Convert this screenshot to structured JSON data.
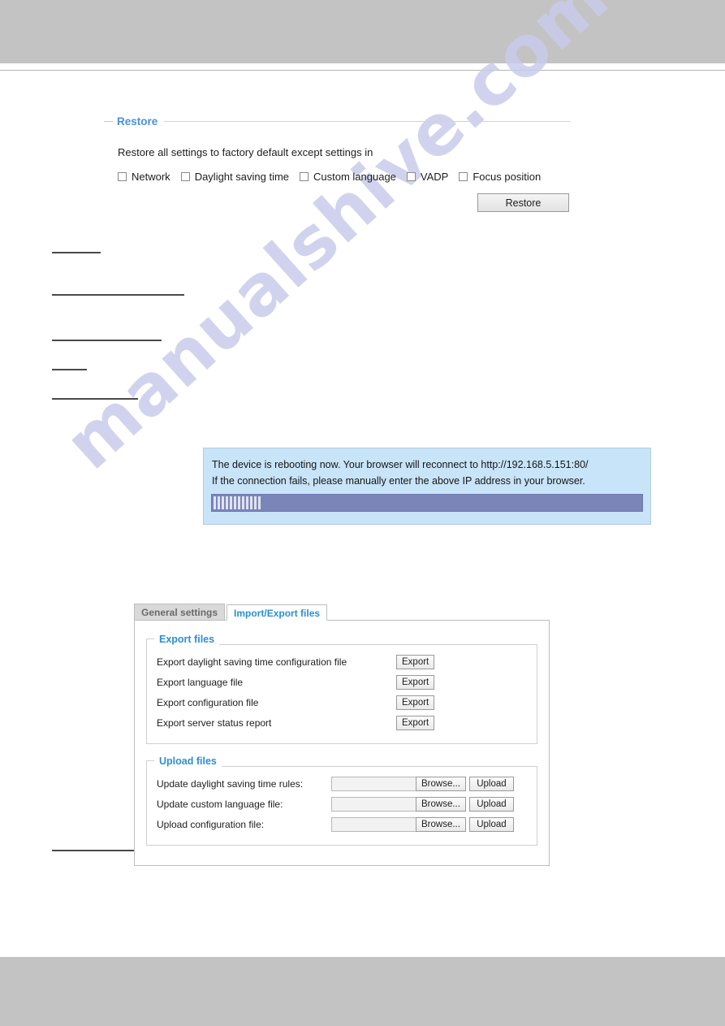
{
  "page": {
    "watermark": "manualshive.com"
  },
  "restore": {
    "legend": "Restore",
    "description": "Restore all settings to factory default except settings in",
    "checkboxes": [
      {
        "label": "Network",
        "checked": false
      },
      {
        "label": "Daylight saving time",
        "checked": false
      },
      {
        "label": "Custom language",
        "checked": false
      },
      {
        "label": "VADP",
        "checked": false
      },
      {
        "label": "Focus position",
        "checked": false
      }
    ],
    "button_label": "Restore"
  },
  "reboot_dialog": {
    "line1": "The device is rebooting now. Your browser will reconnect to http://192.168.5.151:80/",
    "line2": "If the connection fails, please manually enter the above IP address in your browser.",
    "progress_percent": 11
  },
  "tabs": [
    {
      "label": "General settings",
      "active": false
    },
    {
      "label": "Import/Export files",
      "active": true
    }
  ],
  "export_files": {
    "legend": "Export files",
    "rows": [
      {
        "label": "Export daylight saving time configuration file",
        "button": "Export"
      },
      {
        "label": "Export language file",
        "button": "Export"
      },
      {
        "label": "Export configuration file",
        "button": "Export"
      },
      {
        "label": "Export server status report",
        "button": "Export"
      }
    ]
  },
  "upload_files": {
    "legend": "Upload files",
    "rows": [
      {
        "label": "Update daylight saving time rules:",
        "value": "",
        "browse": "Browse...",
        "upload": "Upload"
      },
      {
        "label": "Update custom language file:",
        "value": "",
        "browse": "Browse...",
        "upload": "Upload"
      },
      {
        "label": "Upload configuration file:",
        "value": "",
        "browse": "Browse...",
        "upload": "Upload"
      }
    ]
  },
  "colors": {
    "accent_blue": "#2b8fd4",
    "legend_blue": "#4a90d9",
    "band_gray": "#c3c3c3",
    "dialog_blue": "#c8e4f8",
    "progress_track": "#7b85b8",
    "watermark": "#c9ccec"
  }
}
